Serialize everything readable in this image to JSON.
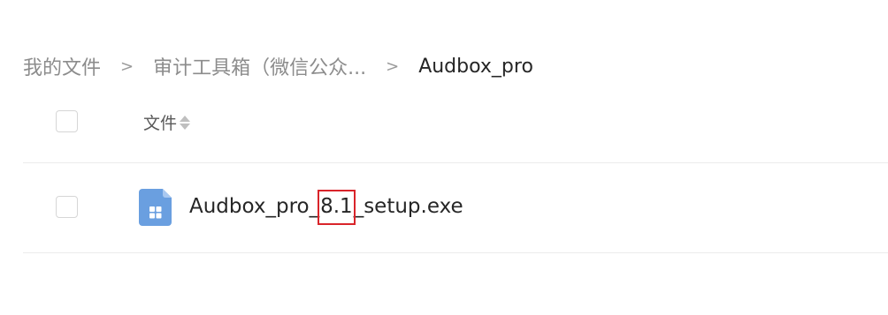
{
  "breadcrumb": {
    "items": [
      "我的文件",
      "审计工具箱（微信公众...",
      "Audbox_pro"
    ],
    "separator": ">"
  },
  "table": {
    "column_name": "文件"
  },
  "files": [
    {
      "name_prefix": "Audbox_pro_",
      "name_highlight": "8.1",
      "name_suffix": "_setup.exe",
      "icon": "exe-file-icon"
    }
  ],
  "colors": {
    "file_icon": "#6a9fe0",
    "highlight_box": "#d9242a"
  }
}
